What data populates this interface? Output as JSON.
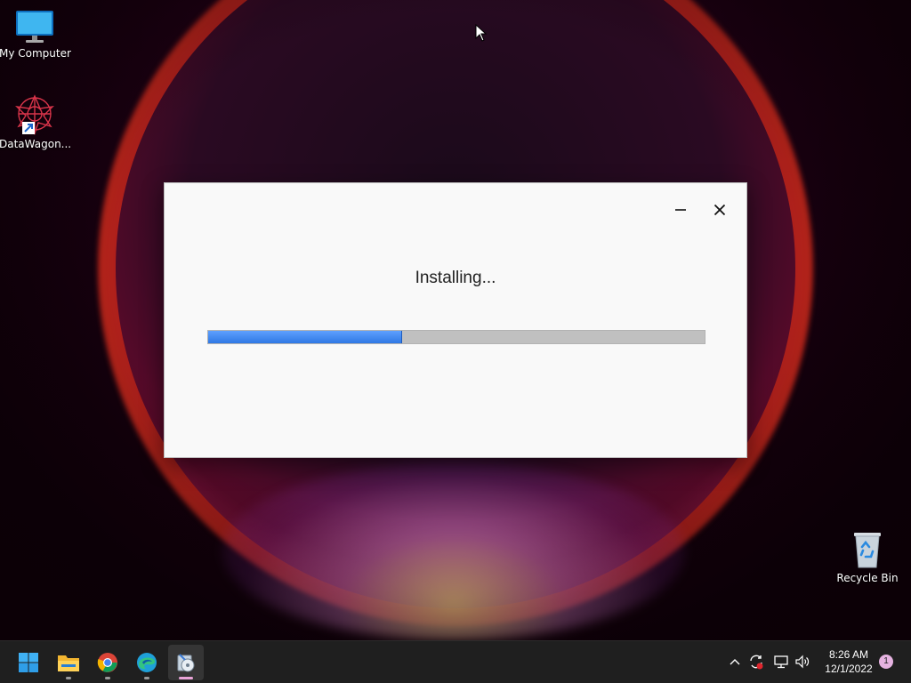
{
  "desktop": {
    "icons": [
      {
        "label": "My Computer"
      },
      {
        "label": "DataWagon..."
      },
      {
        "label": "Recycle Bin"
      }
    ]
  },
  "installer": {
    "status": "Installing...",
    "progress_fraction": 0.39,
    "minimize_icon": "minimize-icon",
    "close_icon": "close-icon"
  },
  "taskbar": {
    "apps": [
      "start-menu",
      "file-explorer",
      "chrome",
      "edge",
      "installer"
    ],
    "active_app": "installer",
    "clock": {
      "time": "8:26 AM",
      "date": "12/1/2022"
    },
    "notification_count": "1"
  },
  "colors": {
    "progress": "#3a86f0",
    "track": "#c0c0c0",
    "taskbar": "#1f1f1f",
    "badge": "#e5b2e0"
  }
}
